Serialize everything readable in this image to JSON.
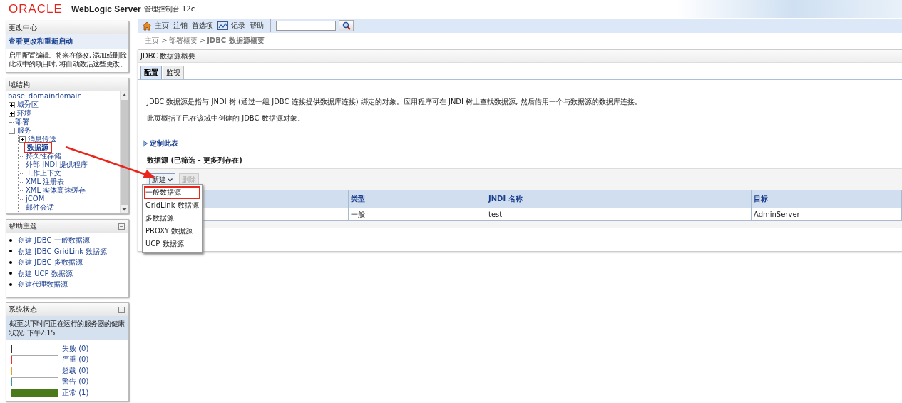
{
  "header": {
    "logo": "ORACLE",
    "product": "WebLogic Server",
    "subtitle": "管理控制台 12c"
  },
  "change_center": {
    "title": "更改中心",
    "link": "查看更改和重新启动",
    "text": "启用配置编辑。将来在修改, 添加或删除此域中的项目时, 将自动激活这些更改。"
  },
  "domain_structure": {
    "title": "域结构",
    "root": "base_domaindomain",
    "items": [
      {
        "label": "域分区",
        "expanded": false,
        "highlighted": false
      },
      {
        "label": "环境",
        "expanded": false,
        "highlighted": false
      },
      {
        "label": "部署",
        "highlighted": false
      },
      {
        "label": "服务",
        "expanded": true,
        "highlighted": false,
        "children": [
          {
            "label": "消息传送",
            "expanded": false,
            "highlighted": false
          },
          {
            "label": "数据源",
            "highlighted": true
          },
          {
            "label": "持久性存储",
            "highlighted": false
          },
          {
            "label": "外部 JNDI 提供程序",
            "highlighted": false
          },
          {
            "label": "工作上下文",
            "highlighted": false
          },
          {
            "label": "XML 注册表",
            "highlighted": false
          },
          {
            "label": "XML 实体高速缓存",
            "highlighted": false
          },
          {
            "label": "jCOM",
            "highlighted": false
          },
          {
            "label": "邮件会话",
            "highlighted": false
          }
        ]
      }
    ]
  },
  "help_topics": {
    "title": "帮助主题",
    "links": [
      "创建 JDBC 一般数据源",
      "创建 JDBC GridLink 数据源",
      "创建 JDBC 多数据源",
      "创建 UCP 数据源",
      "创建代理数据源"
    ]
  },
  "system_status": {
    "title": "系统状态",
    "summary": "截至以下时间正在运行的服务器的健康状况: 下午2:15",
    "items": [
      {
        "label": "失败 (0)",
        "color": "#333333",
        "level": 0
      },
      {
        "label": "严重 (0)",
        "color": "#dd3333",
        "level": 0
      },
      {
        "label": "超载 (0)",
        "color": "#e0a020",
        "level": 0
      },
      {
        "label": "警告 (0)",
        "color": "#3a9a9a",
        "level": 0
      },
      {
        "label": "正常 (1)",
        "color": "#4a7a1a",
        "level": 1
      }
    ]
  },
  "toolbar": {
    "items": [
      {
        "kind": "home",
        "label": "主页"
      },
      {
        "kind": "text",
        "label": "注销"
      },
      {
        "kind": "text",
        "label": "首选项"
      },
      {
        "kind": "chart",
        "label": "记录"
      },
      {
        "kind": "text",
        "label": "帮助"
      }
    ]
  },
  "breadcrumb": [
    "主页 >",
    "部署概要 >",
    "JDBC 数据源概要"
  ],
  "page": {
    "title": "JDBC 数据源概要",
    "tabs": [
      {
        "label": "配置",
        "selected": true
      },
      {
        "label": "监视",
        "selected": false
      }
    ],
    "description": [
      "JDBC 数据源是指与 JNDI 树 (通过一组 JDBC 连接提供数据库连接) 绑定的对象。应用程序可在 JNDI 树上查找数据源, 然后借用一个与数据源的数据库连接。",
      "此页概括了已在该域中创建的 JDBC 数据源对象。"
    ],
    "customize_link": "定制此表",
    "table_title": "数据源 (已筛选 - 更多列存在)",
    "buttons": [
      {
        "label": "新建",
        "disabled": false,
        "kind": "dropdown"
      },
      {
        "label": "删除",
        "disabled": true,
        "kind": "plain"
      }
    ],
    "menu": [
      {
        "label": "一般数据源",
        "highlighted": true
      },
      {
        "label": "GridLink 数据源",
        "highlighted": false
      },
      {
        "label": "多数据源",
        "highlighted": false
      },
      {
        "label": "PROXY 数据源",
        "highlighted": false
      },
      {
        "label": "UCP 数据源",
        "highlighted": false
      }
    ],
    "table": {
      "columns": [
        "类型",
        "JNDI 名称",
        "目标"
      ],
      "rows": [
        [
          "一般",
          "test",
          "AdminServer"
        ]
      ]
    }
  }
}
